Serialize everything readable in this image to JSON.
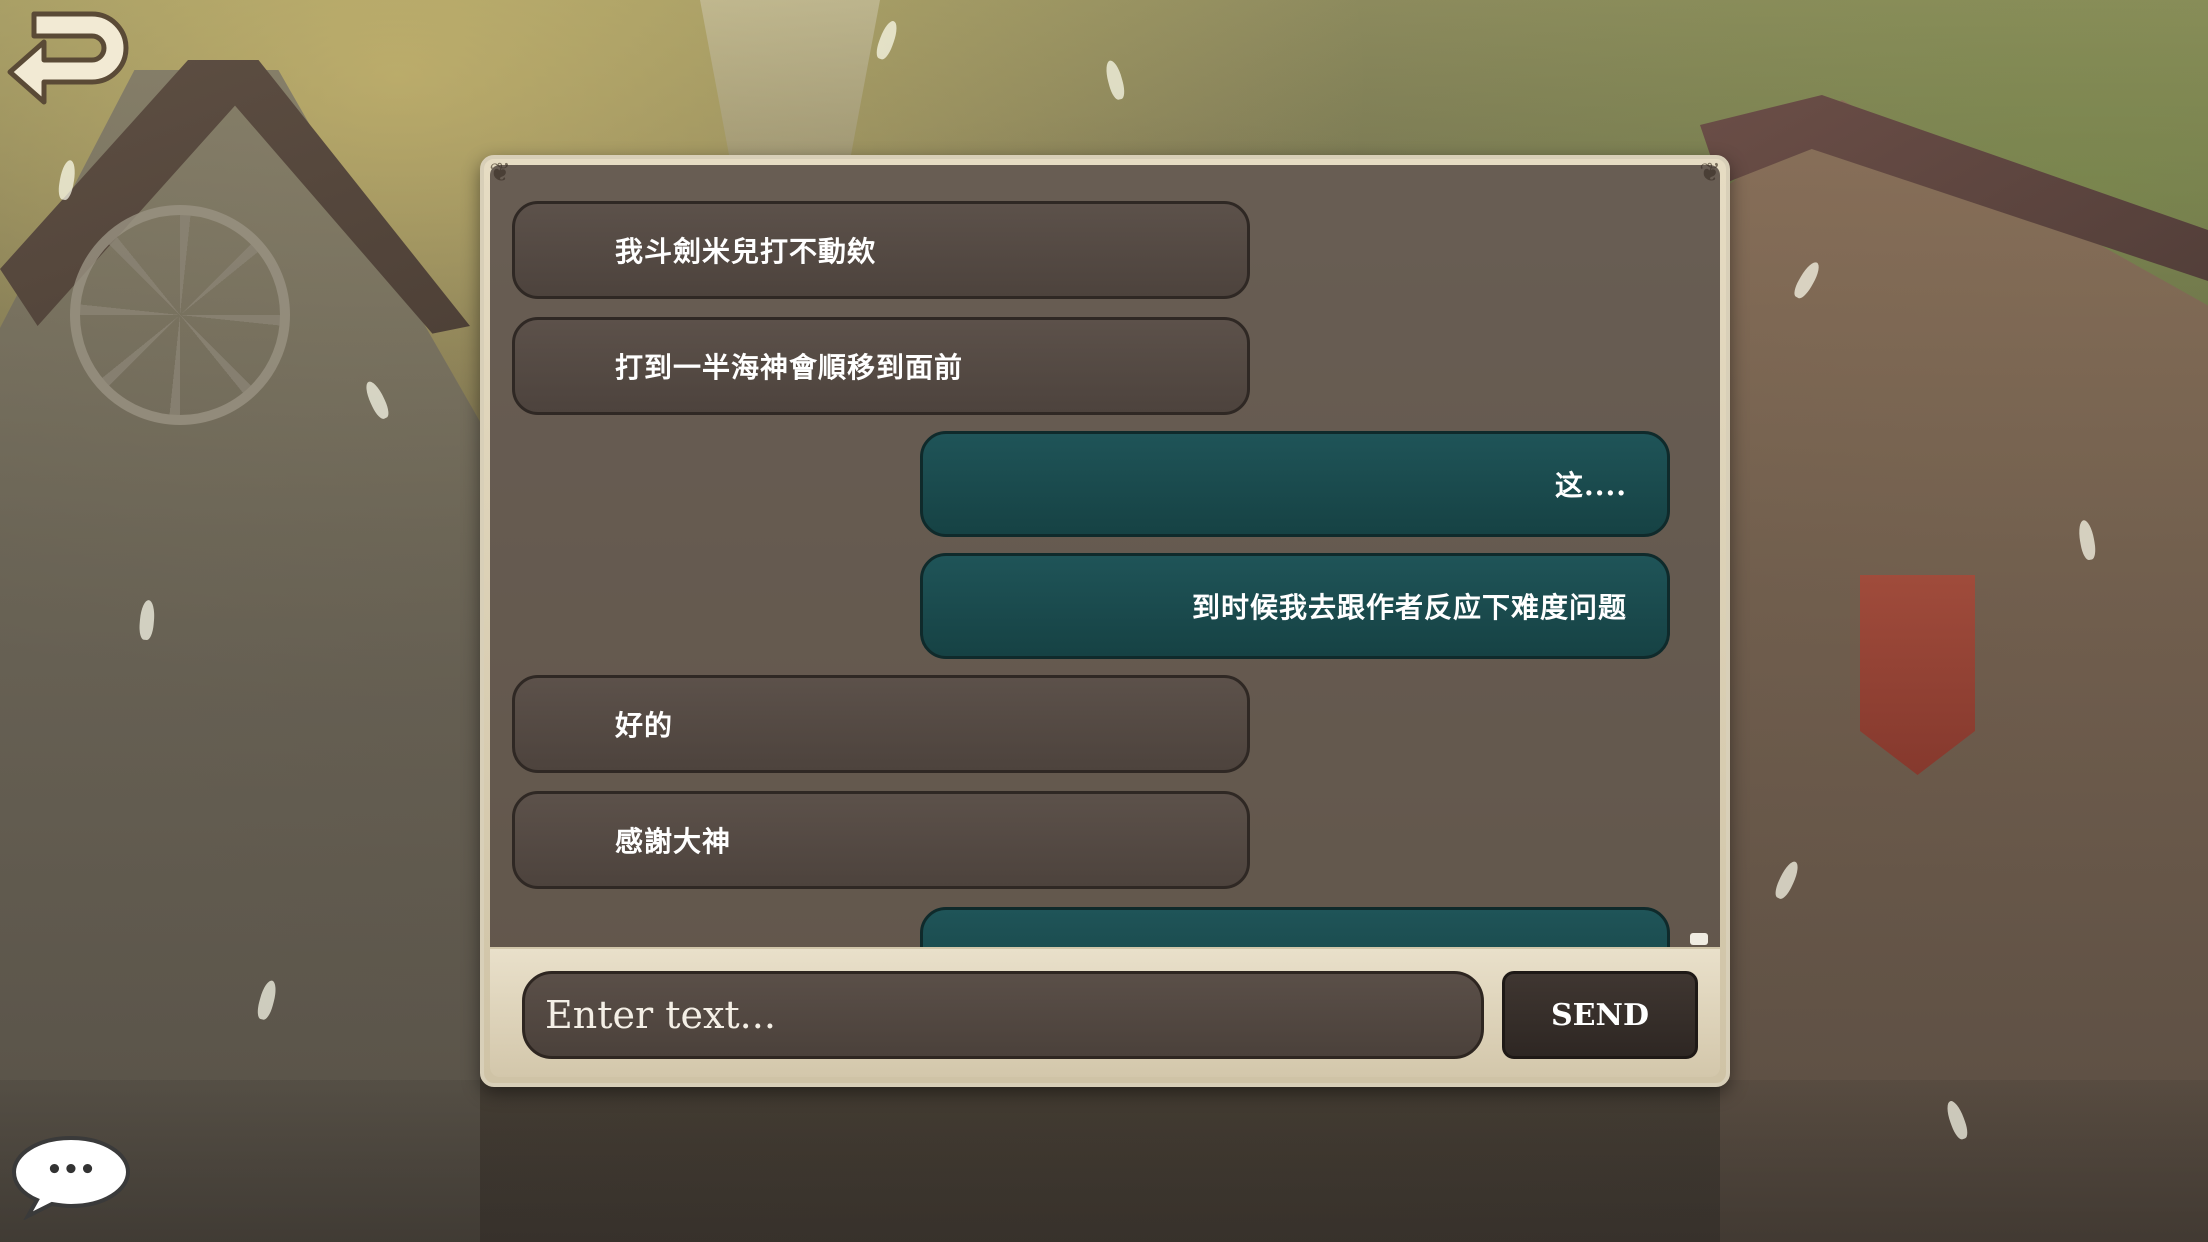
{
  "colors": {
    "other_bubble": "#4f453f",
    "self_bubble": "#1a4a4d",
    "frame": "#ddd3bc",
    "send_button": "#342c28"
  },
  "nav": {
    "back_icon": "curved-back-arrow-icon",
    "chat_toggle_icon": "speech-bubble-dots-icon",
    "chat_toggle_glyph": "•••"
  },
  "chat": {
    "messages": [
      {
        "side": "other",
        "text": "我斗劍米兒打不動欸"
      },
      {
        "side": "other",
        "text": "打到一半海神會順移到面前"
      },
      {
        "side": "self",
        "text": "这...."
      },
      {
        "side": "self",
        "text": "到时候我去跟作者反应下难度问题"
      },
      {
        "side": "other",
        "text": "好的"
      },
      {
        "side": "other",
        "text": "感謝大神"
      },
      {
        "side": "self",
        "text": ""
      }
    ]
  },
  "input": {
    "placeholder": "Enter text...",
    "value": "",
    "send_label": "SEND"
  }
}
